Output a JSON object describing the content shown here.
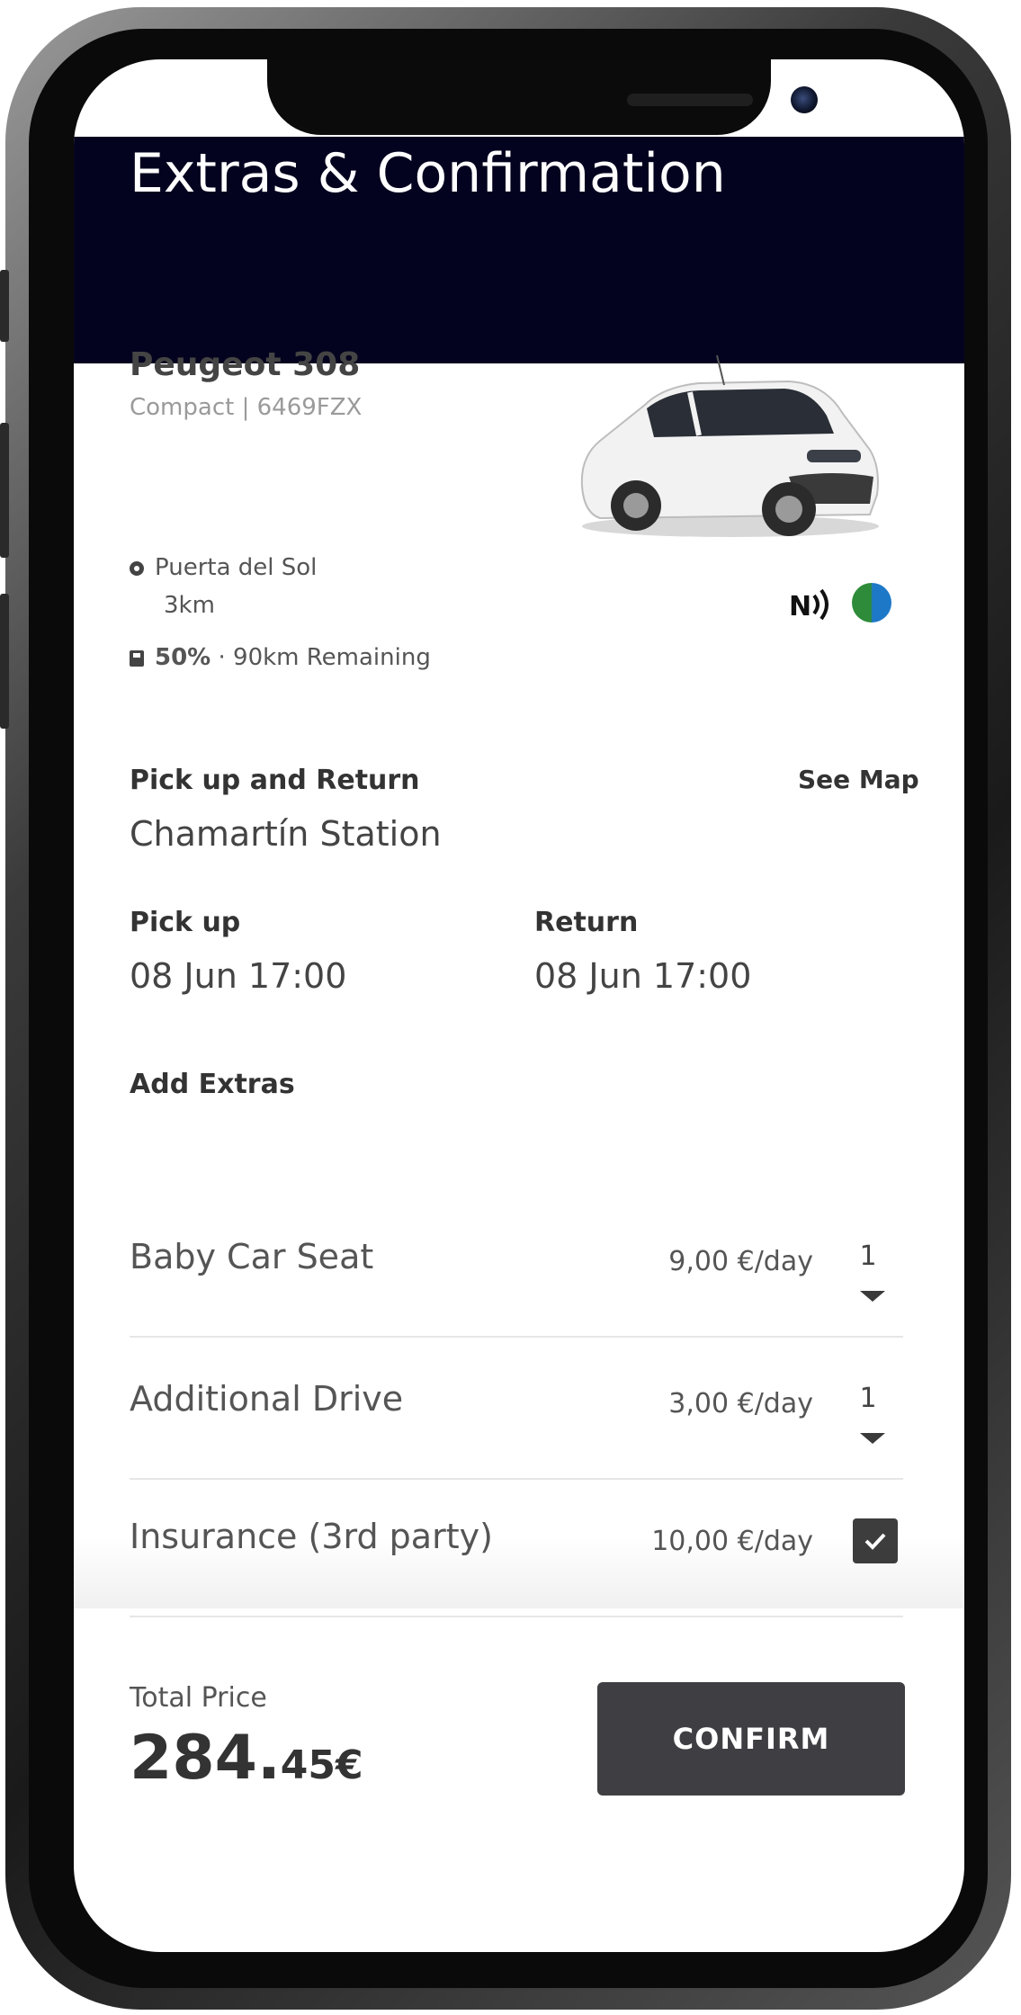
{
  "header": {
    "title": "Extras & Confirmation"
  },
  "car": {
    "name": "Peugeot 308",
    "subtitle": "Compact | 6469FZX",
    "location": "Puerta del Sol",
    "distance": "3km",
    "fuel_percent": "50%",
    "fuel_remaining": " · 90km Remaining",
    "fuel_level": 0.5
  },
  "pickup_return": {
    "label": "Pick up and Return",
    "see_map": "See Map",
    "location": "Chamartín Station"
  },
  "pickup": {
    "label": "Pick up",
    "value": "08 Jun 17:00"
  },
  "return": {
    "label": "Return",
    "value": "08 Jun 17:00"
  },
  "extras": {
    "title": "Add Extras",
    "items": [
      {
        "name": "Baby Car Seat",
        "price": "9,00 €/day",
        "qty": "1"
      },
      {
        "name": "Additional Drive",
        "price": "3,00 €/day",
        "qty": "1"
      },
      {
        "name": "Insurance (3rd party)",
        "price": "10,00 €/day",
        "checked": true
      }
    ]
  },
  "footer": {
    "total_label": "Total Price",
    "total_main": "284.",
    "total_decimal": "45€",
    "confirm_label": "CONFIRM"
  },
  "colors": {
    "header_bg": "#04031f",
    "button_bg": "#3f3f43",
    "eco_green": "#2e8b3a",
    "eco_blue": "#1e78c8"
  }
}
